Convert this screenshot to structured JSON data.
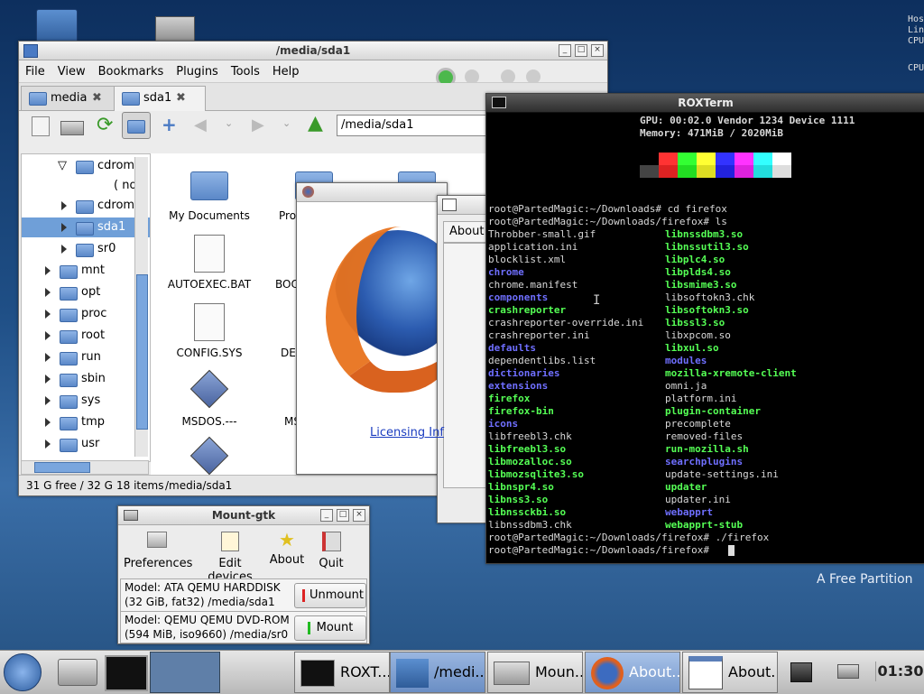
{
  "file_manager": {
    "title": "/media/sda1",
    "menu": [
      "File",
      "View",
      "Bookmarks",
      "Plugins",
      "Tools",
      "Help"
    ],
    "tabs": [
      {
        "label": "media"
      },
      {
        "label": "sda1"
      }
    ],
    "path": "/media/sda1",
    "tree": [
      "cdrom",
      "( no",
      "cdrom",
      "sda1",
      "sr0",
      "mnt",
      "opt",
      "proc",
      "root",
      "run",
      "sbin",
      "sys",
      "tmp",
      "usr"
    ],
    "files": [
      "My Documents",
      "Pro",
      "AUTOEXEC.BAT",
      "BOO",
      "CONFIG.SYS",
      "DE",
      "MSDOS.---",
      "MS"
    ],
    "status": {
      "free": "31 G free / 32 G",
      "items": "18 items",
      "path": "/media/sda1"
    }
  },
  "about_window": {
    "tab": "About",
    "link": "Licensing Inf"
  },
  "terminal": {
    "title": "ROXTerm",
    "gpu_line": "GPU: 00:02.0 Vendor 1234 Device 1111",
    "memory_line": "Memory: 471MiB / 2020MiB",
    "palette": [
      "#000000",
      "#ff3333",
      "#33ff33",
      "#ffff33",
      "#3333ff",
      "#ff33ff",
      "#33ffff",
      "#ffffff",
      "#444444",
      "#dd2222",
      "#22dd22",
      "#dddd22",
      "#2222dd",
      "#dd22dd",
      "#22dddd",
      "#dddddd"
    ],
    "cmd1": "root@PartedMagic:~/Downloads# cd firefox",
    "cmd2": "root@PartedMagic:~/Downloads/firefox# ls",
    "col1": [
      [
        "Throbber-small.gif",
        "w"
      ],
      [
        "application.ini",
        "w"
      ],
      [
        "blocklist.xml",
        "w"
      ],
      [
        "chrome",
        "b"
      ],
      [
        "chrome.manifest",
        "w"
      ],
      [
        "components",
        "b"
      ],
      [
        "crashreporter",
        "g"
      ],
      [
        "crashreporter-override.ini",
        "w"
      ],
      [
        "crashreporter.ini",
        "w"
      ],
      [
        "defaults",
        "b"
      ],
      [
        "dependentlibs.list",
        "w"
      ],
      [
        "dictionaries",
        "b"
      ],
      [
        "extensions",
        "b"
      ],
      [
        "firefox",
        "g"
      ],
      [
        "firefox-bin",
        "g"
      ],
      [
        "icons",
        "b"
      ],
      [
        "libfreebl3.chk",
        "w"
      ],
      [
        "libfreebl3.so",
        "g"
      ],
      [
        "libmozalloc.so",
        "g"
      ],
      [
        "libmozsqlite3.so",
        "g"
      ],
      [
        "libnspr4.so",
        "g"
      ],
      [
        "libnss3.so",
        "g"
      ],
      [
        "libnssckbi.so",
        "g"
      ],
      [
        "libnssdbm3.chk",
        "w"
      ]
    ],
    "col2": [
      [
        "libnssdbm3.so",
        "g"
      ],
      [
        "libnssutil3.so",
        "g"
      ],
      [
        "libplc4.so",
        "g"
      ],
      [
        "libplds4.so",
        "g"
      ],
      [
        "libsmime3.so",
        "g"
      ],
      [
        "libsoftokn3.chk",
        "w"
      ],
      [
        "libsoftokn3.so",
        "g"
      ],
      [
        "libssl3.so",
        "g"
      ],
      [
        "libxpcom.so",
        "w"
      ],
      [
        "libxul.so",
        "g"
      ],
      [
        "modules",
        "b"
      ],
      [
        "mozilla-xremote-client",
        "g"
      ],
      [
        "omni.ja",
        "w"
      ],
      [
        "platform.ini",
        "w"
      ],
      [
        "plugin-container",
        "g"
      ],
      [
        "precomplete",
        "w"
      ],
      [
        "removed-files",
        "w"
      ],
      [
        "run-mozilla.sh",
        "g"
      ],
      [
        "searchplugins",
        "b"
      ],
      [
        "update-settings.ini",
        "w"
      ],
      [
        "updater",
        "g"
      ],
      [
        "updater.ini",
        "w"
      ],
      [
        "webapprt",
        "b"
      ],
      [
        "webapprt-stub",
        "g"
      ]
    ],
    "cmd3": "root@PartedMagic:~/Downloads/firefox# ./firefox",
    "cmd4": "root@PartedMagic:~/Downloads/firefox# "
  },
  "mount": {
    "title": "Mount-gtk",
    "toolbar": [
      "Preferences",
      "Edit devices",
      "About",
      "Quit"
    ],
    "dev1": {
      "line1": "Model: ATA QEMU HARDDISK",
      "line2": "(32 GiB, fat32)  /media/sda1",
      "action": "Unmount"
    },
    "dev2": {
      "line1": "Model: QEMU QEMU DVD-ROM",
      "line2": "(594 MiB, iso9660)  /media/sr0",
      "action": "Mount"
    }
  },
  "desktop": {
    "brand": "A Free Partition",
    "side_right": [
      "Hos",
      "Lin",
      "CPU",
      "CPU"
    ]
  },
  "taskbar": {
    "items": [
      "ROXT...",
      "/medi...",
      "Moun...",
      "About...",
      "About..."
    ],
    "clock": "01:30"
  }
}
